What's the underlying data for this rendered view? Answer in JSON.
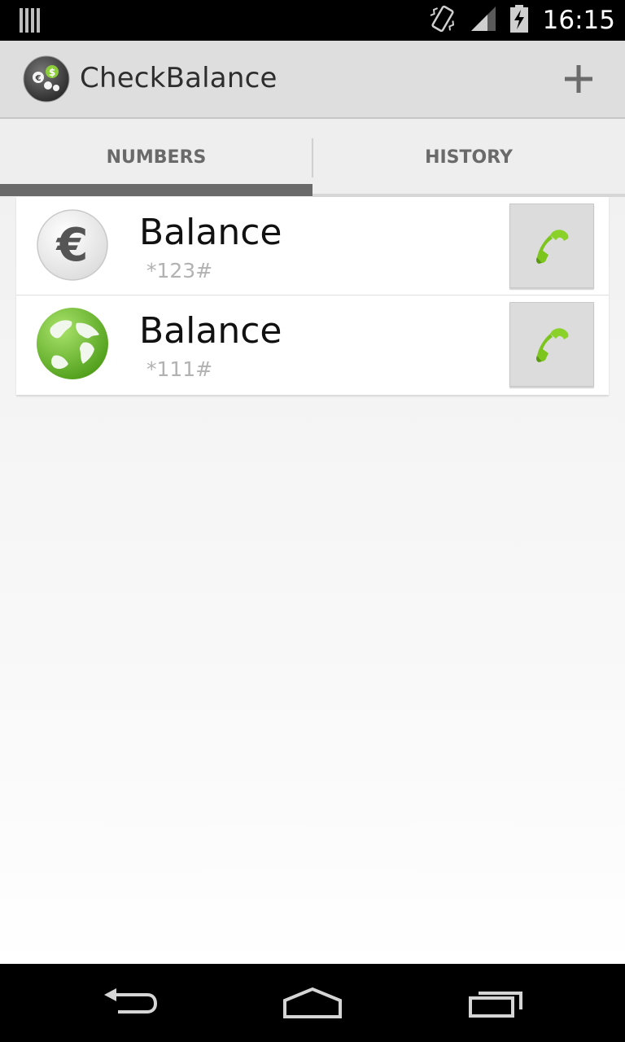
{
  "status_bar": {
    "time": "16:15",
    "icons": [
      "notification-bars-icon",
      "vibrate-icon",
      "signal-icon",
      "battery-charging-icon"
    ]
  },
  "action_bar": {
    "title": "CheckBalance",
    "add_icon": "plus-icon"
  },
  "tabs": [
    {
      "label": "NUMBERS",
      "selected": true
    },
    {
      "label": "HISTORY",
      "selected": false
    }
  ],
  "entries": [
    {
      "name": "Balance",
      "code": "*123#",
      "icon": "euro-icon",
      "action_icon": "phone-icon"
    },
    {
      "name": "Balance",
      "code": "*111#",
      "icon": "globe-icon",
      "action_icon": "phone-icon"
    }
  ],
  "nav_bar": {
    "icons": [
      "back-icon",
      "home-icon",
      "recent-apps-icon"
    ]
  },
  "colors": {
    "accent_green": "#7cc51d",
    "tab_indicator": "#6a6a6a",
    "action_bar_bg": "#dedede"
  }
}
